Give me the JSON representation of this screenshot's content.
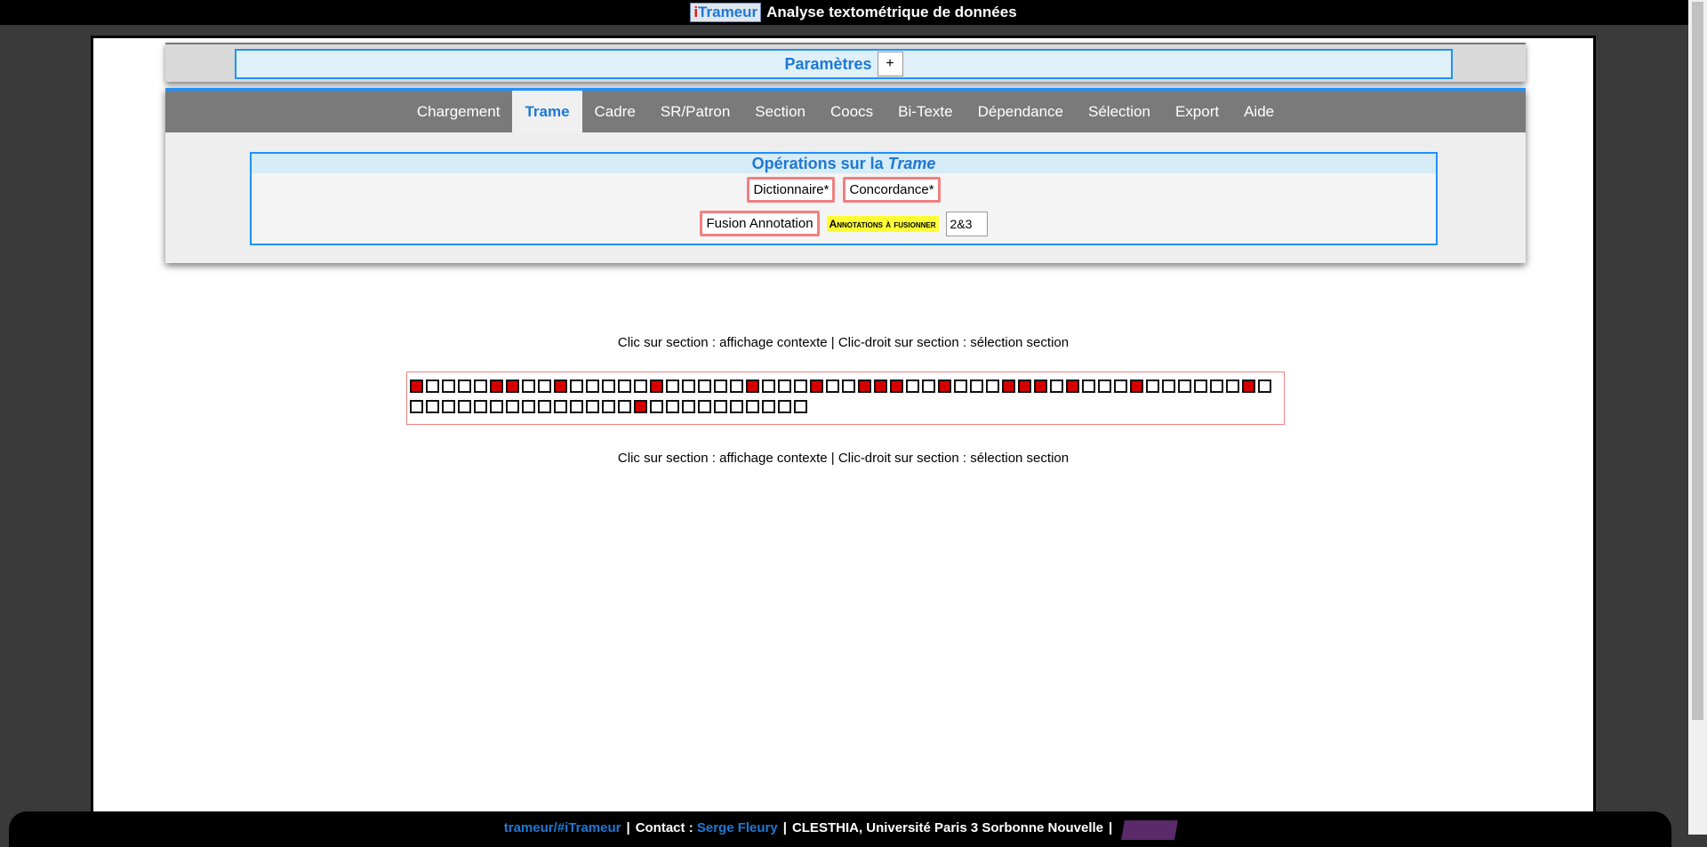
{
  "header": {
    "brand_i": "i",
    "brand_rest": "Trameur",
    "title": "Analyse textométrique de données"
  },
  "params": {
    "title": "Paramètres",
    "toggle": "+"
  },
  "tabs": [
    {
      "label": "Chargement",
      "active": false
    },
    {
      "label": "Trame",
      "active": true
    },
    {
      "label": "Cadre",
      "active": false
    },
    {
      "label": "SR/Patron",
      "active": false
    },
    {
      "label": "Section",
      "active": false
    },
    {
      "label": "Coocs",
      "active": false
    },
    {
      "label": "Bi-Texte",
      "active": false
    },
    {
      "label": "Dépendance",
      "active": false
    },
    {
      "label": "Sélection",
      "active": false
    },
    {
      "label": "Export",
      "active": false
    },
    {
      "label": "Aide",
      "active": false
    }
  ],
  "ops": {
    "title_prefix": "Opérations sur la",
    "title_em": "Trame",
    "dictionary_btn": "Dictionnaire*",
    "concordance_btn": "Concordance*",
    "fusion_btn": "Fusion Annotation",
    "annot_label": "Annotations à fusionner",
    "annot_value": "2&3"
  },
  "hint": "Clic sur section : affichage contexte | Clic-droit sur section : sélection section",
  "sections": {
    "row1": [
      1,
      0,
      0,
      0,
      0,
      1,
      1,
      0,
      0,
      1,
      0,
      0,
      0,
      0,
      0,
      1,
      0,
      0,
      0,
      0,
      0,
      1,
      0,
      0,
      0,
      1,
      0,
      0,
      1,
      1,
      1,
      0,
      0,
      1,
      0,
      0,
      0,
      1,
      1,
      1,
      0,
      1,
      0,
      0,
      0,
      1,
      0,
      0,
      0,
      0,
      0,
      0,
      1,
      0
    ],
    "row2": [
      0,
      0,
      0,
      0,
      0,
      0,
      0,
      0,
      0,
      0,
      0,
      0,
      0,
      0,
      1,
      0,
      0,
      0,
      0,
      0,
      0,
      0,
      0,
      0,
      0
    ]
  },
  "colors": {
    "accent": "#1e90ff",
    "selected_section": "#d40000",
    "button_border": "#f08080",
    "annot_highlight": "#ffff33"
  },
  "footer": {
    "link1": "trameur/#iTrameur",
    "contact_label": "Contact :",
    "contact_name": "Serge Fleury",
    "institution": "CLESTHIA, Université Paris 3 Sorbonne Nouvelle"
  }
}
